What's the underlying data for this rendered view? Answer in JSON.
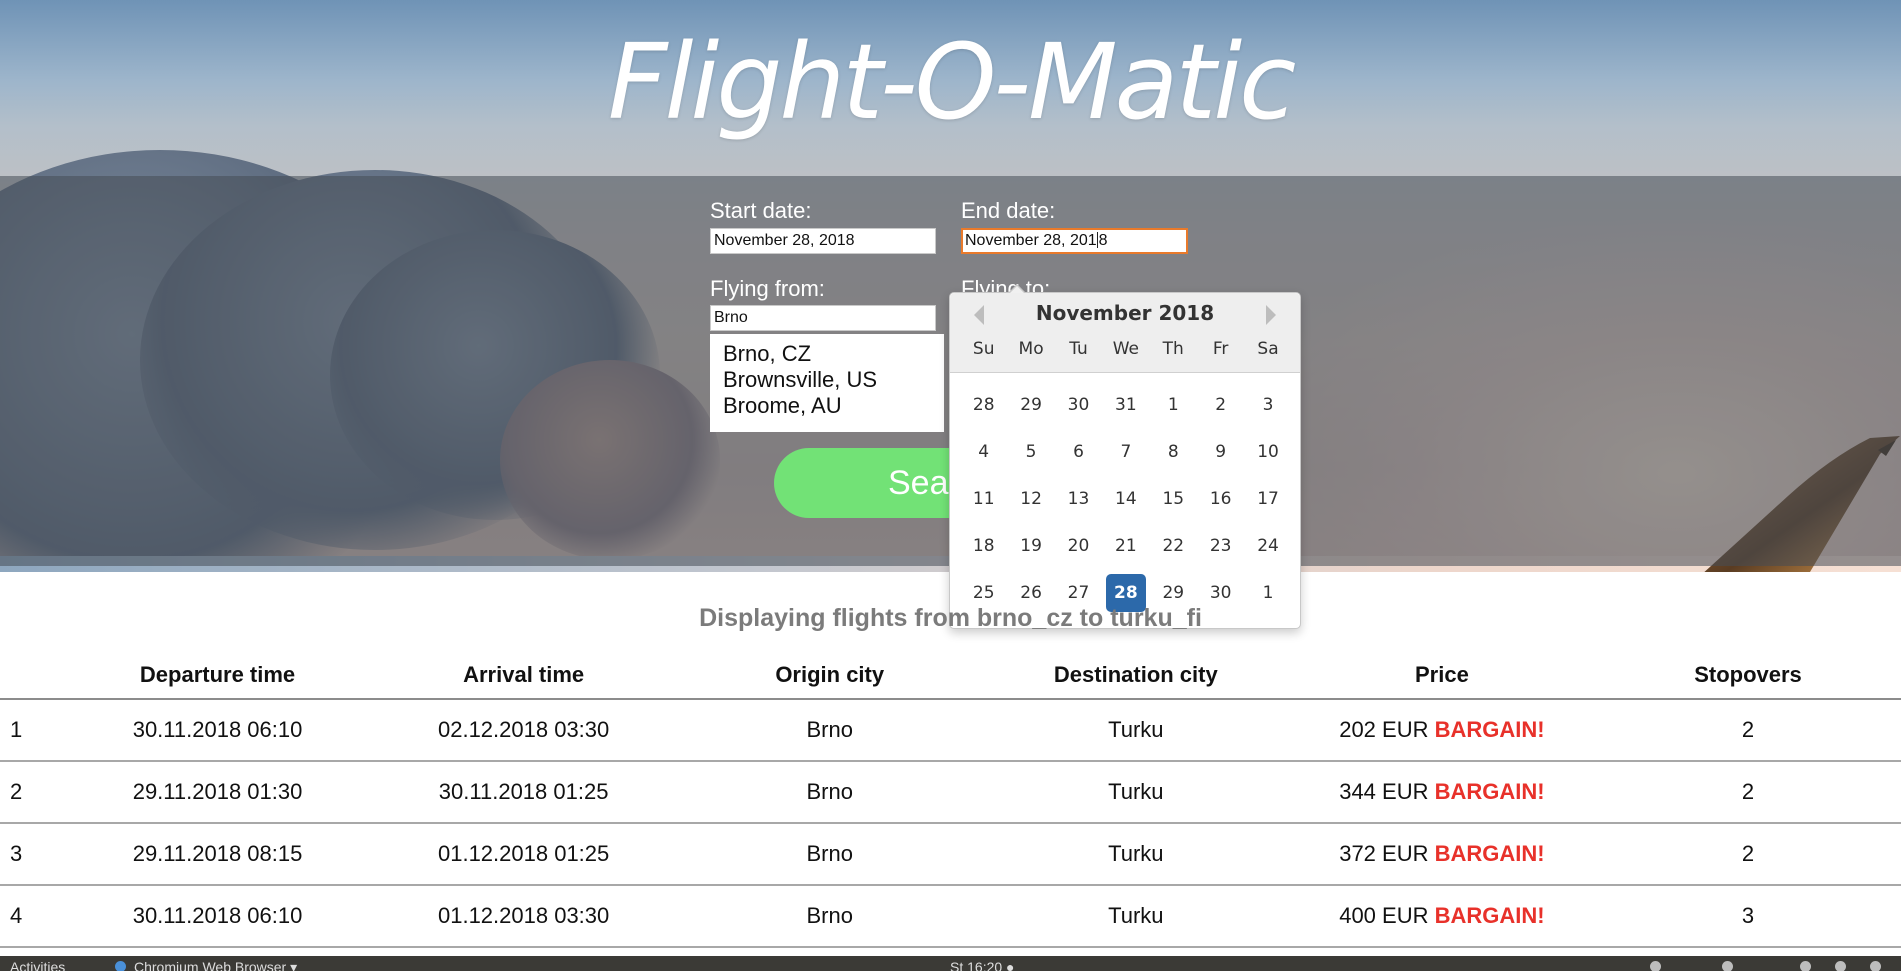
{
  "app": {
    "title": "Flight-O-Matic"
  },
  "form": {
    "start_date": {
      "label": "Start date:",
      "value": "November 28, 2018"
    },
    "end_date": {
      "label": "End date:",
      "value_before_caret": "November 28, 201",
      "value_after_caret": "8"
    },
    "flying_from": {
      "label": "Flying from:",
      "value": "Brno"
    },
    "flying_to": {
      "label": "Flying to:"
    },
    "suggestions": [
      "Brno, CZ",
      "Brownsville, US",
      "Broome, AU"
    ],
    "search_label": "Search"
  },
  "datepicker": {
    "month_title": "November 2018",
    "weekdays": [
      "Su",
      "Mo",
      "Tu",
      "We",
      "Th",
      "Fr",
      "Sa"
    ],
    "weeks": [
      [
        "28",
        "29",
        "30",
        "31",
        "1",
        "2",
        "3"
      ],
      [
        "4",
        "5",
        "6",
        "7",
        "8",
        "9",
        "10"
      ],
      [
        "11",
        "12",
        "13",
        "14",
        "15",
        "16",
        "17"
      ],
      [
        "18",
        "19",
        "20",
        "21",
        "22",
        "23",
        "24"
      ],
      [
        "25",
        "26",
        "27",
        "28",
        "29",
        "30",
        "1"
      ]
    ],
    "selected_day": "28",
    "colors": {
      "selected": "#2c69aa"
    }
  },
  "results": {
    "heading": "Displaying flights from brno_cz to turku_fi",
    "columns": [
      "",
      "Departure time",
      "Arrival time",
      "Origin city",
      "Destination city",
      "Price",
      "Stopovers"
    ],
    "rows": [
      {
        "index": "1",
        "departure": "30.11.2018 06:10",
        "arrival": "02.12.2018 03:30",
        "origin": "Brno",
        "destination": "Turku",
        "price": "202 EUR",
        "badge": "BARGAIN!",
        "stopovers": "2"
      },
      {
        "index": "2",
        "departure": "29.11.2018 01:30",
        "arrival": "30.11.2018 01:25",
        "origin": "Brno",
        "destination": "Turku",
        "price": "344 EUR",
        "badge": "BARGAIN!",
        "stopovers": "2"
      },
      {
        "index": "3",
        "departure": "29.11.2018 08:15",
        "arrival": "01.12.2018 01:25",
        "origin": "Brno",
        "destination": "Turku",
        "price": "372 EUR",
        "badge": "BARGAIN!",
        "stopovers": "2"
      },
      {
        "index": "4",
        "departure": "30.11.2018 06:10",
        "arrival": "01.12.2018 03:30",
        "origin": "Brno",
        "destination": "Turku",
        "price": "400 EUR",
        "badge": "BARGAIN!",
        "stopovers": "3"
      }
    ],
    "colors": {
      "bargain": "#e8312a"
    }
  },
  "taskbar": {
    "activities": "Activities",
    "app_menu": "Chromium Web Browser ▾",
    "clock": "St 16:20 ●"
  },
  "colors": {
    "search_button": "#72e276",
    "focus_border": "#e97a2b"
  }
}
